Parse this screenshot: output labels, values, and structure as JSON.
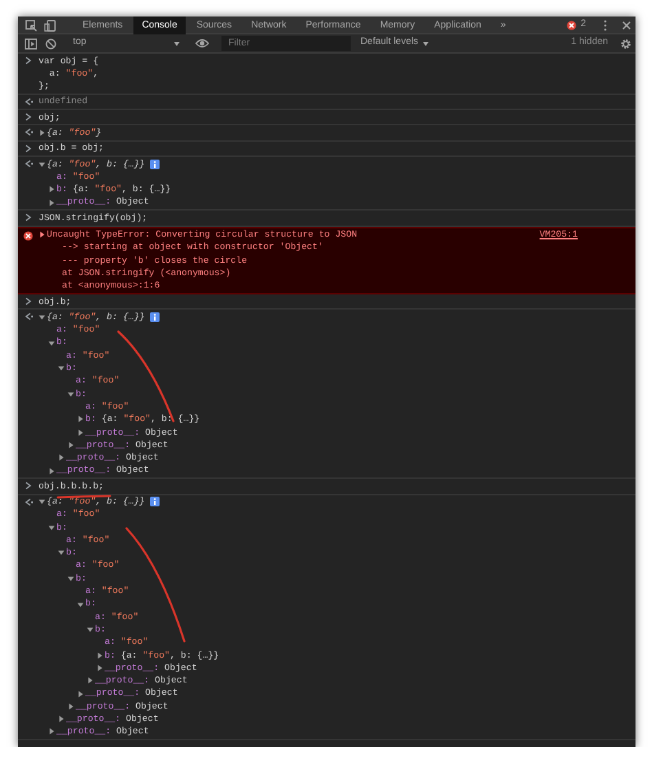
{
  "tabs": [
    {
      "label": "Elements",
      "selected": false
    },
    {
      "label": "Console",
      "selected": true
    },
    {
      "label": "Sources",
      "selected": false
    },
    {
      "label": "Network",
      "selected": false
    },
    {
      "label": "Performance",
      "selected": false
    },
    {
      "label": "Memory",
      "selected": false
    },
    {
      "label": "Application",
      "selected": false
    }
  ],
  "more_tabs": "»",
  "error_count": "2",
  "toolbar": {
    "context": "top",
    "filter_placeholder": "Filter",
    "levels": "Default levels",
    "hidden_count": "1 hidden"
  },
  "console": [
    {
      "kind": "input",
      "lines": [
        "var obj = {",
        "  a: \"foo\",",
        "};"
      ]
    },
    {
      "kind": "result",
      "text": "undefined"
    },
    {
      "kind": "input",
      "lines": [
        "obj;"
      ]
    },
    {
      "kind": "object",
      "tree": {
        "text": "{a: \"foo\"}",
        "expanded": false
      }
    },
    {
      "kind": "input",
      "lines": [
        "obj.b = obj;"
      ]
    },
    {
      "kind": "object",
      "tree": {
        "text": "{a: \"foo\", b: {…}}",
        "expanded": true,
        "info": true,
        "children": [
          {
            "text": "a: \"foo\""
          },
          {
            "text": "b: {a: \"foo\", b: {…}}",
            "expanded": false
          },
          {
            "text": "__proto__: Object",
            "expanded": false
          }
        ]
      }
    },
    {
      "kind": "input",
      "lines": [
        "JSON.stringify(obj);"
      ]
    },
    {
      "kind": "error",
      "expanded": false,
      "lines": [
        "Uncaught TypeError: Converting circular structure to JSON",
        "--> starting at object with constructor 'Object'",
        "--- property 'b' closes the circle",
        "at JSON.stringify (<anonymous>)",
        "at <anonymous>:1:6"
      ],
      "source": "VM205:1"
    },
    {
      "kind": "input",
      "lines": [
        "obj.b;"
      ]
    },
    {
      "kind": "object",
      "tree": {
        "text": "{a: \"foo\", b: {…}}",
        "expanded": true,
        "info": true,
        "children": [
          {
            "text": "a: \"foo\""
          },
          {
            "text": "b:",
            "expanded": true,
            "children": [
              {
                "text": "a: \"foo\""
              },
              {
                "text": "b:",
                "expanded": true,
                "children": [
                  {
                    "text": "a: \"foo\""
                  },
                  {
                    "text": "b:",
                    "expanded": true,
                    "children": [
                      {
                        "text": "a: \"foo\""
                      },
                      {
                        "text": "b: {a: \"foo\", b: {…}}",
                        "expanded": false
                      },
                      {
                        "text": "__proto__: Object",
                        "expanded": false
                      }
                    ]
                  },
                  {
                    "text": "__proto__: Object",
                    "expanded": false
                  }
                ]
              },
              {
                "text": "__proto__: Object",
                "expanded": false
              }
            ]
          },
          {
            "text": "__proto__: Object",
            "expanded": false
          }
        ]
      }
    },
    {
      "kind": "input",
      "lines": [
        "obj.b.b.b.b;"
      ]
    },
    {
      "kind": "object",
      "tree": {
        "text": "{a: \"foo\", b: {…}}",
        "expanded": true,
        "info": true,
        "children": [
          {
            "text": "a: \"foo\""
          },
          {
            "text": "b:",
            "expanded": true,
            "children": [
              {
                "text": "a: \"foo\""
              },
              {
                "text": "b:",
                "expanded": true,
                "children": [
                  {
                    "text": "a: \"foo\""
                  },
                  {
                    "text": "b:",
                    "expanded": true,
                    "children": [
                      {
                        "text": "a: \"foo\""
                      },
                      {
                        "text": "b:",
                        "expanded": true,
                        "children": [
                          {
                            "text": "a: \"foo\""
                          },
                          {
                            "text": "b:",
                            "expanded": true,
                            "children": [
                              {
                                "text": "a: \"foo\""
                              },
                              {
                                "text": "b: {a: \"foo\", b: {…}}",
                                "expanded": false
                              },
                              {
                                "text": "__proto__: Object",
                                "expanded": false
                              }
                            ]
                          },
                          {
                            "text": "__proto__: Object",
                            "expanded": false
                          }
                        ]
                      },
                      {
                        "text": "__proto__: Object",
                        "expanded": false
                      }
                    ]
                  },
                  {
                    "text": "__proto__: Object",
                    "expanded": false
                  }
                ]
              },
              {
                "text": "__proto__: Object",
                "expanded": false
              }
            ]
          },
          {
            "text": "__proto__: Object",
            "expanded": false
          }
        ]
      }
    }
  ]
}
